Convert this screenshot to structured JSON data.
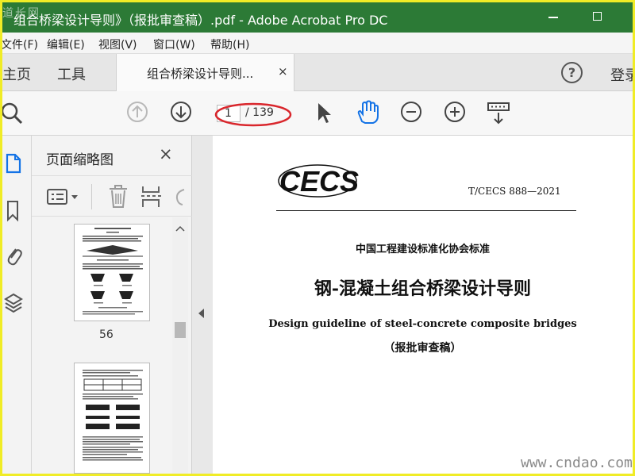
{
  "window": {
    "title": "组合桥梁设计导则》（报批审查稿）.pdf - Adobe Acrobat Pro DC",
    "watermark_logo": "道长网"
  },
  "menu": [
    "文件(F)",
    "编辑(E)",
    "视图(V)",
    "窗口(W)",
    "帮助(H)"
  ],
  "tabs": {
    "home": "主页",
    "tools": "工具",
    "document": "组合桥梁设计导则...",
    "close": "×",
    "help": "?",
    "signin": "登录"
  },
  "toolbar": {
    "current_page": "1",
    "total_pages": "/ 139",
    "highlight_color": "#d9262c",
    "icons": [
      "search-icon",
      "page-up-icon",
      "page-down-icon",
      "select-cursor-icon",
      "hand-tool-icon",
      "zoom-out-icon",
      "zoom-in-icon",
      "scroll-mode-icon"
    ]
  },
  "left_rail": {
    "icons": [
      "page-thumbnails-icon",
      "bookmark-icon",
      "attachment-icon",
      "layers-icon"
    ],
    "active_color": "#1473e6"
  },
  "thumbnail_panel": {
    "title": "页面缩略图",
    "close": "×",
    "tools": [
      "options-menu-icon",
      "delete-icon",
      "insert-icon",
      "rotate-icon"
    ],
    "pages": [
      {
        "number": "56"
      },
      {
        "number": ""
      }
    ]
  },
  "document": {
    "logo": "CECS",
    "standard_code": "T/CECS 888—2021",
    "association": "中国工程建设标准化协会标准",
    "title_cn": "钢-混凝土组合桥梁设计导则",
    "title_en": "Design guideline of steel-concrete composite bridges",
    "status": "（报批审查稿）"
  },
  "watermark": "www.cndao.com",
  "colors": {
    "border": "#f0ec26",
    "titlebar": "#2c7a36"
  }
}
